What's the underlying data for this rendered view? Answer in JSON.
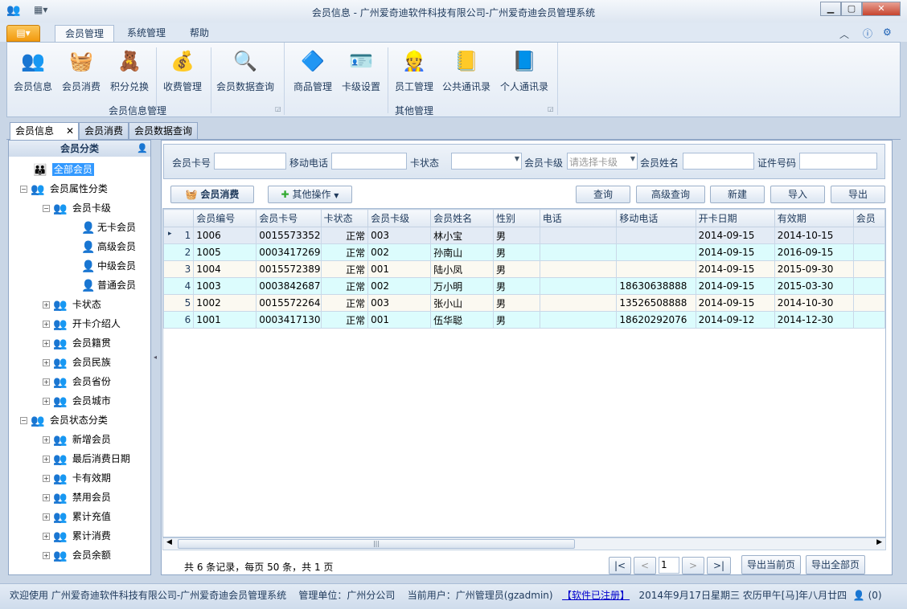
{
  "window": {
    "title": "会员信息 - 广州爱奇迪软件科技有限公司-广州爱奇迪会员管理系统"
  },
  "ribbon": {
    "tabs": [
      "会员管理",
      "系统管理",
      "帮助"
    ],
    "groups": [
      {
        "label": "会员信息管理",
        "buttons": [
          "会员信息",
          "会员消费",
          "积分兑换",
          "收费管理",
          "会员数据查询"
        ]
      },
      {
        "label": "其他管理",
        "buttons": [
          "商品管理",
          "卡级设置",
          "员工管理",
          "公共通讯录",
          "个人通讯录"
        ]
      }
    ]
  },
  "doc_tabs": [
    "会员信息",
    "会员消费",
    "会员数据查询"
  ],
  "left_panel": {
    "title": "会员分类",
    "root": "全部会员",
    "attr_group": "会员属性分类",
    "card_level": "会员卡级",
    "card_levels": [
      "无卡会员",
      "高级会员",
      "中级会员",
      "普通会员"
    ],
    "attr_items": [
      "卡状态",
      "开卡介绍人",
      "会员籍贯",
      "会员民族",
      "会员省份",
      "会员城市"
    ],
    "status_group": "会员状态分类",
    "status_items": [
      "新增会员",
      "最后消费日期",
      "卡有效期",
      "禁用会员",
      "累计充值",
      "累计消费",
      "会员余额"
    ]
  },
  "search": {
    "card_no_label": "会员卡号",
    "card_no": "",
    "mobile_label": "移动电话",
    "mobile": "",
    "status_label": "卡状态",
    "status": "",
    "level_label": "会员卡级",
    "level_placeholder": "请选择卡级",
    "name_label": "会员姓名",
    "name": "",
    "id_label": "证件号码",
    "id": ""
  },
  "toolbar": {
    "consume": "会员消费",
    "other": "其他操作",
    "query": "查询",
    "advanced": "高级查询",
    "new": "新建",
    "import": "导入",
    "export": "导出"
  },
  "grid": {
    "columns": [
      "会员编号",
      "会员卡号",
      "卡状态",
      "会员卡级",
      "会员姓名",
      "性别",
      "电话",
      "移动电话",
      "开卡日期",
      "有效期",
      "会员"
    ],
    "rows": [
      [
        "1",
        "1006",
        "0015573352",
        "正常",
        "003",
        "林小宝",
        "男",
        "",
        "",
        "2014-09-15",
        "2014-10-15",
        ""
      ],
      [
        "2",
        "1005",
        "0003417269",
        "正常",
        "002",
        "孙南山",
        "男",
        "",
        "",
        "2014-09-15",
        "2016-09-15",
        ""
      ],
      [
        "3",
        "1004",
        "0015572389",
        "正常",
        "001",
        "陆小凤",
        "男",
        "",
        "",
        "2014-09-15",
        "2015-09-30",
        ""
      ],
      [
        "4",
        "1003",
        "0003842687",
        "正常",
        "002",
        "万小明",
        "男",
        "",
        "18630638888",
        "2014-09-15",
        "2015-03-30",
        ""
      ],
      [
        "5",
        "1002",
        "0015572264",
        "正常",
        "003",
        "张小山",
        "男",
        "",
        "13526508888",
        "2014-09-15",
        "2014-10-30",
        ""
      ],
      [
        "6",
        "1001",
        "0003417130",
        "正常",
        "001",
        "伍华聪",
        "男",
        "",
        "18620292076",
        "2014-09-12",
        "2014-12-30",
        ""
      ]
    ]
  },
  "footer": {
    "summary": "共 6 条记录，每页 50 条，共 1 页",
    "page": "1",
    "first": "|<",
    "prev": "<",
    "next": ">",
    "last": ">|",
    "export_page": "导出当前页",
    "export_all": "导出全部页"
  },
  "status": {
    "welcome": "欢迎使用 广州爱奇迪软件科技有限公司-广州爱奇迪会员管理系统",
    "unit": "管理单位：广州分公司",
    "user": "当前用户：广州管理员(gzadmin)",
    "registered": "【软件已注册】",
    "date": "2014年9月17日星期三 农历甲午[马]年八月廿四",
    "count": "(0)"
  }
}
